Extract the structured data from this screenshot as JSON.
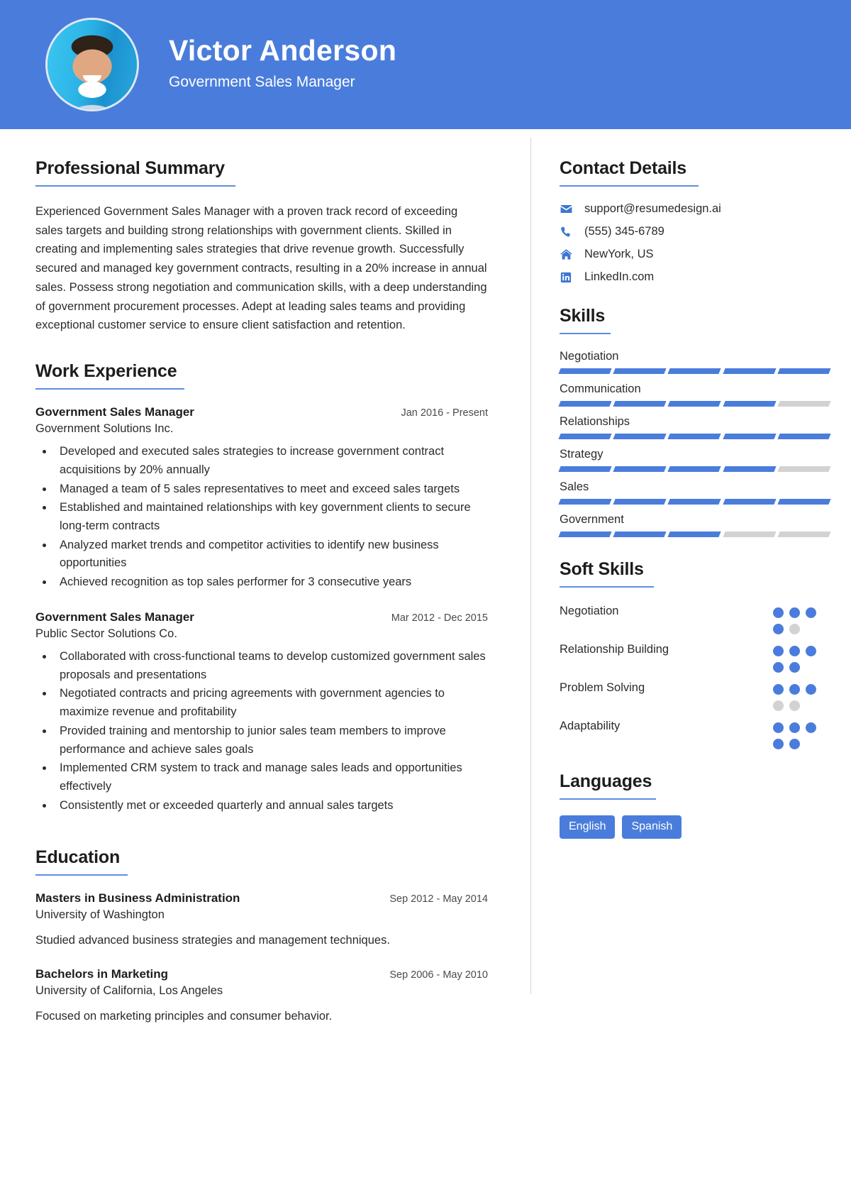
{
  "theme": {
    "accent": "#4a7ddb",
    "rule": "#5b8fe0",
    "muted": "#d2d2d2",
    "text": "#2b2b2b",
    "header_bg": "#4a7ddb"
  },
  "header": {
    "name": "Victor Anderson",
    "role": "Government Sales Manager",
    "avatar_alt": "profile-photo"
  },
  "summary": {
    "title": "Professional Summary",
    "text": "Experienced Government Sales Manager with a proven track record of exceeding sales targets and building strong relationships with government clients. Skilled in creating and implementing sales strategies that drive revenue growth. Successfully secured and managed key government contracts, resulting in a 20% increase in annual sales. Possess strong negotiation and communication skills, with a deep understanding of government procurement processes. Adept at leading sales teams and providing exceptional customer service to ensure client satisfaction and retention."
  },
  "work": {
    "title": "Work Experience",
    "entries": [
      {
        "role": "Government Sales Manager",
        "date": "Jan 2016 - Present",
        "company": "Government Solutions Inc.",
        "bullets": [
          "Developed and executed sales strategies to increase government contract acquisitions by 20% annually",
          "Managed a team of 5 sales representatives to meet and exceed sales targets",
          "Established and maintained relationships with key government clients to secure long-term contracts",
          "Analyzed market trends and competitor activities to identify new business opportunities",
          "Achieved recognition as top sales performer for 3 consecutive years"
        ]
      },
      {
        "role": "Government Sales Manager",
        "date": "Mar 2012 - Dec 2015",
        "company": "Public Sector Solutions Co.",
        "bullets": [
          "Collaborated with cross-functional teams to develop customized government sales proposals and presentations",
          "Negotiated contracts and pricing agreements with government agencies to maximize revenue and profitability",
          "Provided training and mentorship to junior sales team members to improve performance and achieve sales goals",
          "Implemented CRM system to track and manage sales leads and opportunities effectively",
          "Consistently met or exceeded quarterly and annual sales targets"
        ]
      }
    ]
  },
  "education": {
    "title": "Education",
    "entries": [
      {
        "degree": "Masters in Business Administration",
        "date": "Sep 2012 - May 2014",
        "school": "University of Washington",
        "desc": "Studied advanced business strategies and management techniques."
      },
      {
        "degree": "Bachelors in Marketing",
        "date": "Sep 2006 - May 2010",
        "school": "University of California, Los Angeles",
        "desc": "Focused on marketing principles and consumer behavior."
      }
    ]
  },
  "contact": {
    "title": "Contact Details",
    "items": [
      {
        "icon": "envelope-icon",
        "value": "support@resumedesign.ai"
      },
      {
        "icon": "phone-icon",
        "value": "(555) 345-6789"
      },
      {
        "icon": "home-icon",
        "value": "NewYork, US"
      },
      {
        "icon": "linkedin-icon",
        "value": "LinkedIn.com"
      }
    ]
  },
  "skills": {
    "title": "Skills",
    "max": 5,
    "items": [
      {
        "name": "Negotiation",
        "level": 5
      },
      {
        "name": "Communication",
        "level": 4
      },
      {
        "name": "Relationships",
        "level": 5
      },
      {
        "name": "Strategy",
        "level": 4
      },
      {
        "name": "Sales",
        "level": 5
      },
      {
        "name": "Government",
        "level": 3
      }
    ]
  },
  "soft_skills": {
    "title": "Soft Skills",
    "max": 5,
    "items": [
      {
        "name": "Negotiation",
        "level": 4
      },
      {
        "name": "Relationship Building",
        "level": 5
      },
      {
        "name": "Problem Solving",
        "level": 3
      },
      {
        "name": "Adaptability",
        "level": 5
      }
    ]
  },
  "languages": {
    "title": "Languages",
    "items": [
      "English",
      "Spanish"
    ]
  }
}
